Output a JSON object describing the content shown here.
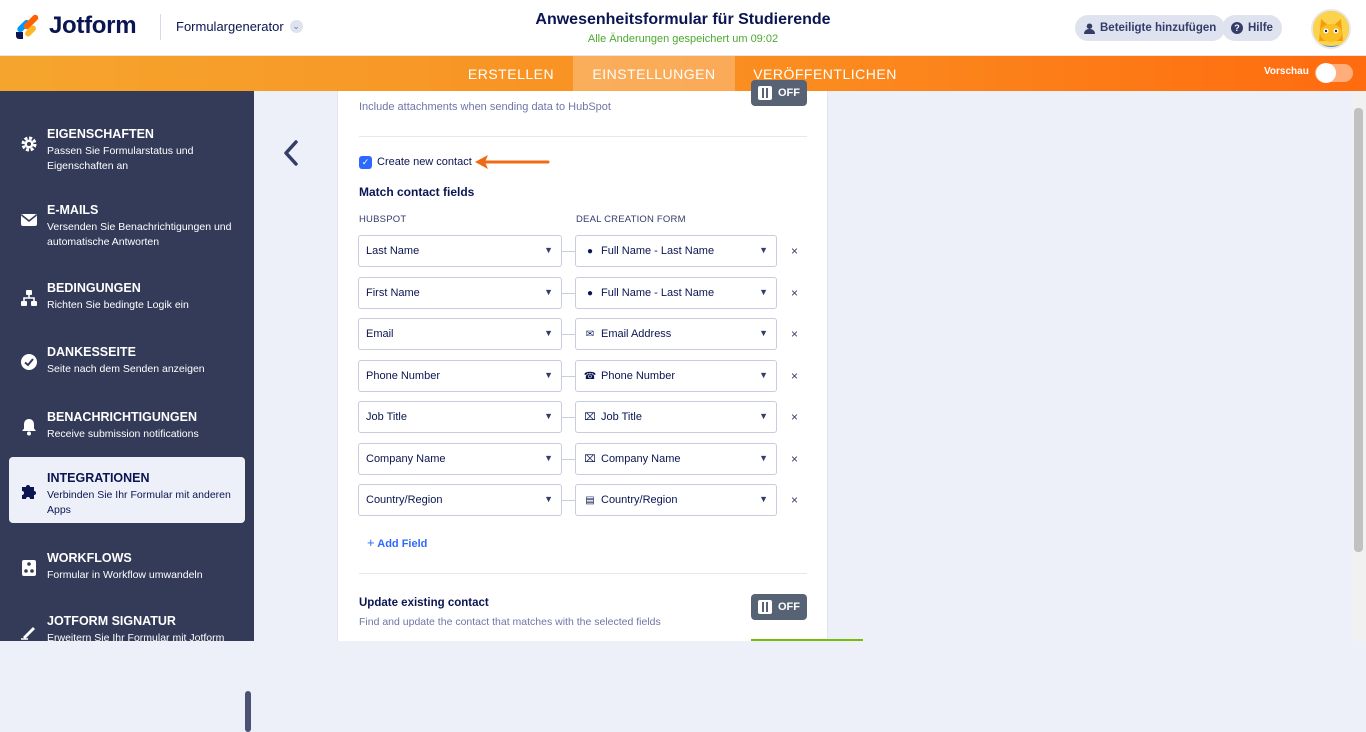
{
  "header": {
    "logo_text": "Jotform",
    "builder_label": "Formulargenerator",
    "form_title": "Anwesenheitsformular für Studierende",
    "save_status": "Alle Änderungen gespeichert um 09:02",
    "add_collaborators": "Beteiligte hinzufügen",
    "help": "Hilfe"
  },
  "nav": {
    "tabs": [
      "ERSTELLEN",
      "EINSTELLUNGEN",
      "VERÖFFENTLICHEN"
    ],
    "active_tab": "EINSTELLUNGEN",
    "preview_label": "Vorschau"
  },
  "sidebar": {
    "items": [
      {
        "title": "EIGENSCHAFTEN",
        "desc": "Passen Sie Formularstatus und Eigenschaften an",
        "icon": "gear-icon"
      },
      {
        "title": "E-MAILS",
        "desc": "Versenden Sie Benachrichtigungen und automatische Antworten",
        "icon": "envelope-icon"
      },
      {
        "title": "BEDINGUNGEN",
        "desc": "Richten Sie bedingte Logik ein",
        "icon": "sitemap-icon"
      },
      {
        "title": "DANKESSEITE",
        "desc": "Seite nach dem Senden anzeigen",
        "icon": "check-circle-icon"
      },
      {
        "title": "BENACHRICHTIGUNGEN",
        "desc": "Receive submission notifications",
        "icon": "bell-icon"
      },
      {
        "title": "INTEGRATIONEN",
        "desc": "Verbinden Sie Ihr Formular mit anderen Apps",
        "icon": "puzzle-icon"
      },
      {
        "title": "WORKFLOWS",
        "desc": "Formular in Workflow umwandeln",
        "icon": "workflow-icon"
      },
      {
        "title": "JOTFORM SIGNATUR",
        "desc": "Erweitern Sie Ihr Formular mit Jotform",
        "icon": "signature-icon"
      }
    ],
    "active": "INTEGRATIONEN"
  },
  "panel": {
    "attachments_desc": "Include attachments when sending data to HubSpot",
    "attachments_toggle": "OFF",
    "create_contact_label": "Create new contact",
    "create_contact_checked": true,
    "match_title": "Match contact fields",
    "col_hubspot": "HUBSPOT",
    "col_form": "DEAL CREATION FORM",
    "rows": [
      {
        "hubspot": "Last Name",
        "form": "Full Name - Last Name",
        "form_icon": "user-icon"
      },
      {
        "hubspot": "First Name",
        "form": "Full Name - Last Name",
        "form_icon": "user-icon"
      },
      {
        "hubspot": "Email",
        "form": "Email Address",
        "form_icon": "envelope-icon"
      },
      {
        "hubspot": "Phone Number",
        "form": "Phone Number",
        "form_icon": "phone-icon"
      },
      {
        "hubspot": "Job Title",
        "form": "Job Title",
        "form_icon": "text-field-icon"
      },
      {
        "hubspot": "Company Name",
        "form": "Company Name",
        "form_icon": "text-field-icon"
      },
      {
        "hubspot": "Country/Region",
        "form": "Country/Region",
        "form_icon": "dropdown-field-icon"
      }
    ],
    "add_field": "Add Field",
    "update_title": "Update existing contact",
    "update_desc": "Find and update the contact that matches with the selected fields",
    "update_toggle": "OFF"
  },
  "colors": {
    "accent": "#ff6b0f",
    "sidebar": "#343b59",
    "link": "#2e69ff",
    "annotation_arrow": "#f06a14"
  }
}
